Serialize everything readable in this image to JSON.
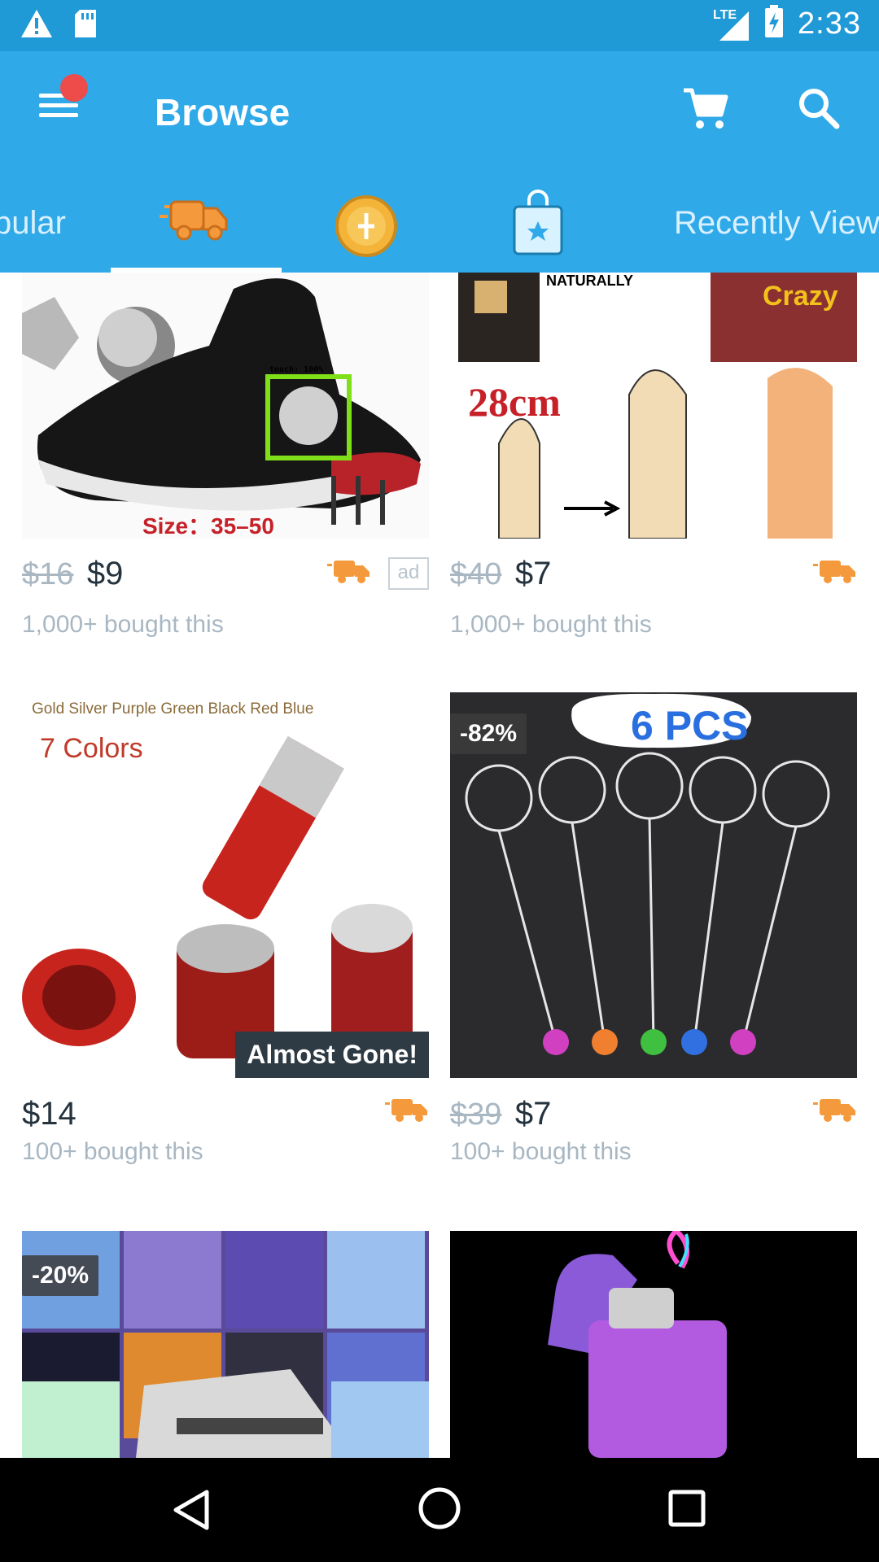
{
  "status_bar": {
    "time": "2:33",
    "network": "LTE",
    "icons": [
      "warning-icon",
      "sd-card-icon",
      "signal-icon",
      "battery-charging-icon"
    ]
  },
  "app_bar": {
    "title": "Browse",
    "icons": [
      "menu-icon",
      "cart-icon",
      "search-icon"
    ],
    "notification_dot_color": "#ee4b4b"
  },
  "tabs": {
    "partial_left_label": "pular",
    "partial_right_label": "Recently View",
    "icon_tabs": [
      "delivery-truck-icon",
      "coin-icon",
      "shopping-bag-star-icon"
    ],
    "selected_index": 1
  },
  "products": [
    {
      "image": "black sneaker with hammer and nails",
      "image_text": "Size：35–50",
      "overlay_label": "touch: 100%",
      "original_price": "$16",
      "price": "$9",
      "bought": "1,000+ bought this",
      "truck": true,
      "ad": "ad"
    },
    {
      "image": "maca supplement illustration",
      "image_text_1": "NATURALLY",
      "image_text_2": "28cm",
      "image_text_3": "Crazy",
      "original_price": "$40",
      "price": "$7",
      "bought": "1,000+ bought this",
      "truck": true
    },
    {
      "image": "red metal grinder parts",
      "image_text_1": "Gold Silver Purple Green Black Red Blue",
      "image_text_2": "7 Colors",
      "badge": "Almost Gone!",
      "price": "$14",
      "bought": "100+ bought this",
      "truck": true
    },
    {
      "image": "glass pipes set",
      "image_text": "6 PCS",
      "discount": "-82%",
      "original_price": "$39",
      "price": "$7",
      "bought": "100+ bought this",
      "truck": true
    },
    {
      "image": "retro game console collage",
      "discount": "-20%"
    },
    {
      "image": "purple electric lighter"
    }
  ],
  "colors": {
    "status_bar": "#1f9ad6",
    "app_bar": "#2fa9e8",
    "truck_orange": "#f59a3c",
    "price_text": "#24333e",
    "muted_text": "#a8b7c2"
  },
  "nav_bar": {
    "icons": [
      "back-icon",
      "home-icon",
      "recents-icon"
    ]
  }
}
